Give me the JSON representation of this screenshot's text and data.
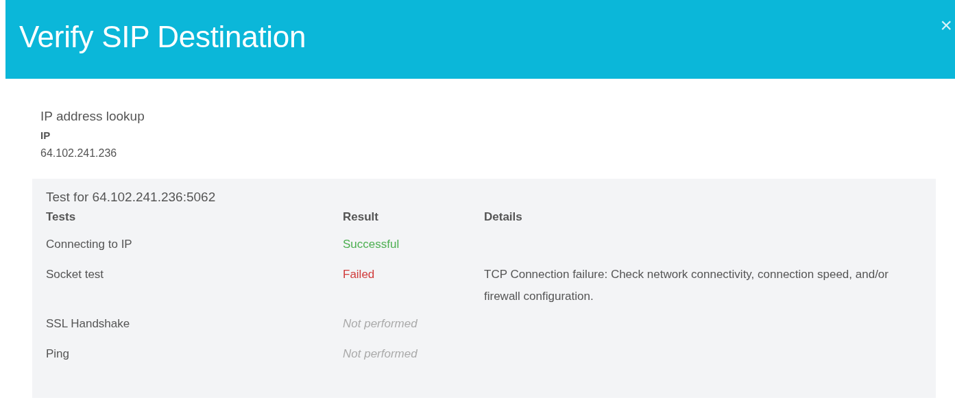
{
  "dialog": {
    "title": "Verify SIP Destination",
    "close": "×"
  },
  "lookup": {
    "heading": "IP address lookup",
    "label": "IP",
    "value": "64.102.241.236"
  },
  "test_panel": {
    "title": "Test for 64.102.241.236:5062",
    "columns": [
      "Tests",
      "Result",
      "Details"
    ],
    "rows": [
      {
        "test": "Connecting to IP",
        "result": "Successful",
        "kind": "success"
      },
      {
        "test": "Socket test",
        "result": "Failed",
        "kind": "failed",
        "details": "TCP Connection failure: Check network connectivity, connection speed, and/or firewall configuration."
      },
      {
        "test": "SSL Handshake",
        "result": "Not performed",
        "kind": "not_performed"
      },
      {
        "test": "Ping",
        "result": "Not performed",
        "kind": "not_performed"
      }
    ]
  }
}
